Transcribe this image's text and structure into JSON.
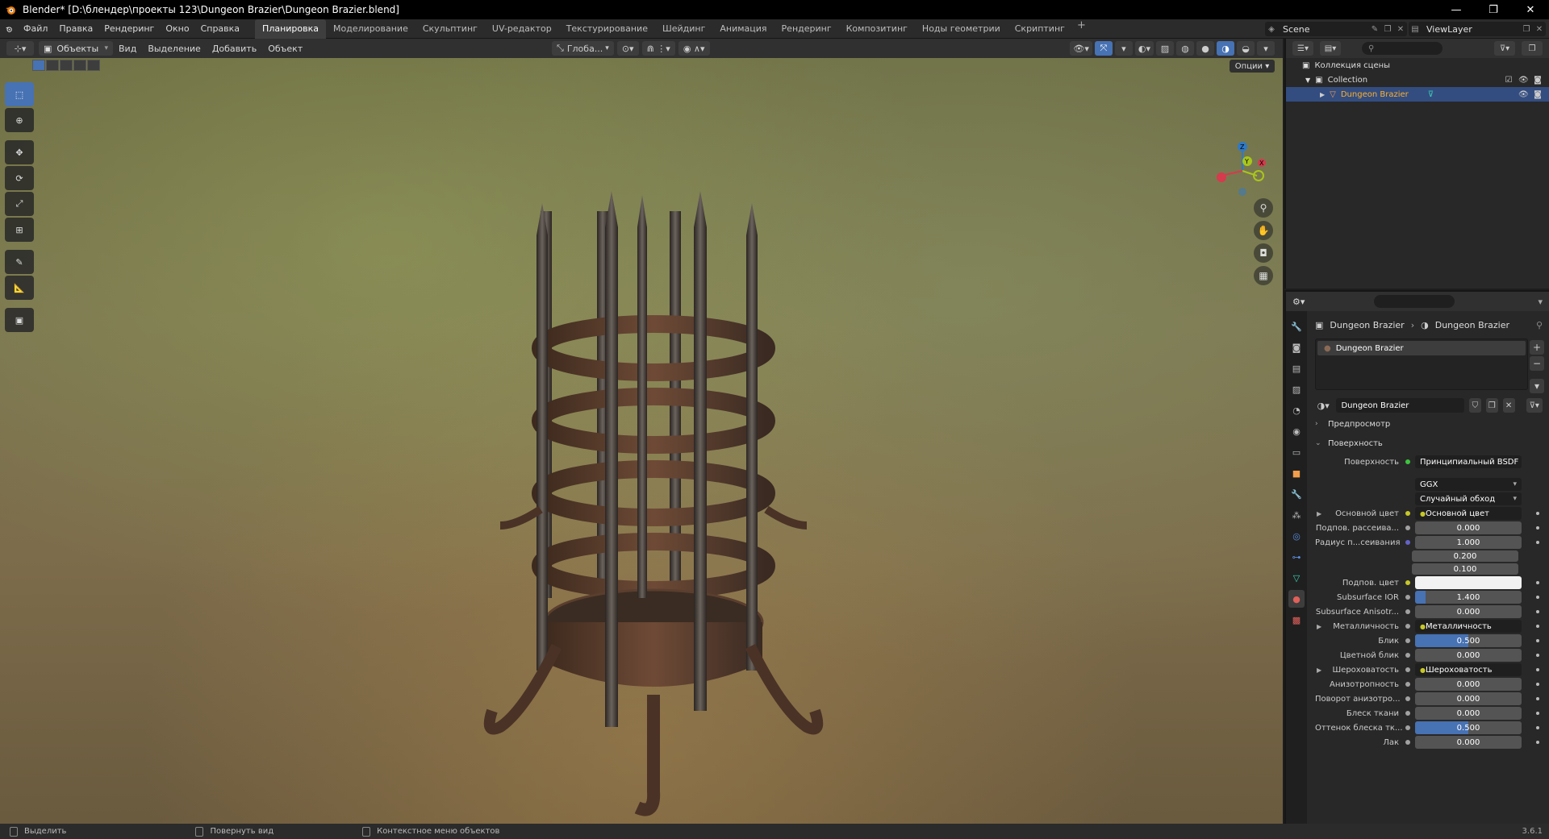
{
  "titlebar": {
    "title": "Blender* [D:\\блендер\\проекты 123\\Dungeon Brazier\\Dungeon Brazier.blend]",
    "minimize": "—",
    "maximize": "❐",
    "close": "✕"
  },
  "menu": {
    "items": [
      "Файл",
      "Правка",
      "Рендеринг",
      "Окно",
      "Справка"
    ]
  },
  "workspaces": {
    "tabs": [
      "Планировка",
      "Моделирование",
      "Скульптинг",
      "UV-редактор",
      "Текстурирование",
      "Шейдинг",
      "Анимация",
      "Рендеринг",
      "Композитинг",
      "Ноды геометрии",
      "Скриптинг"
    ],
    "active": "Планировка",
    "add": "+"
  },
  "scene": {
    "label": "Scene"
  },
  "view_layer": {
    "label": "ViewLayer"
  },
  "viewport_header": {
    "mode": "Объекты",
    "menus": [
      "Вид",
      "Выделение",
      "Добавить",
      "Объект"
    ],
    "transform_orientation": "Глоба...",
    "options": "Опции"
  },
  "toolbar": {
    "tools": [
      "select-box",
      "cursor",
      "move",
      "rotate",
      "scale",
      "transform",
      "annotate",
      "measure",
      "add-cube"
    ]
  },
  "gizmo": {
    "x": "X",
    "y": "Y",
    "z": "Z"
  },
  "statusbar": {
    "items": [
      "Выделить",
      "Повернуть вид",
      "Контекстное меню объектов"
    ],
    "version": "3.6.1"
  },
  "outliner": {
    "rows": [
      {
        "label": "Коллекция сцены"
      },
      {
        "label": "Collection"
      },
      {
        "label": "Dungeon Brazier"
      }
    ]
  },
  "properties": {
    "breadcrumb_object": "Dungeon Brazier",
    "breadcrumb_material": "Dungeon Brazier",
    "slot": "Dungeon Brazier",
    "material_name": "Dungeon Brazier",
    "panel_preview": "Предпросмотр",
    "panel_surface": "Поверхность",
    "surface_label": "Поверхность",
    "surface_value": "Принципиальный BSDF",
    "distribution": "GGX",
    "subsurface_method": "Случайный обход",
    "fields": [
      {
        "label": "Основной цвет",
        "value": "Основной цвет",
        "kind": "link",
        "sock": "#c7c729",
        "expand": true
      },
      {
        "label": "Подпов. рассеива...",
        "value": "0.000",
        "kind": "num",
        "sock": "#a1a1a1",
        "fill": 0
      },
      {
        "label": "Радиус п...сеивания",
        "value": "1.000",
        "kind": "num",
        "sock": "#6363c7",
        "fill": 0
      },
      {
        "label": "Подпов. цвет",
        "value": "",
        "kind": "white",
        "sock": "#c7c729"
      },
      {
        "label": "Subsurface IOR",
        "value": "1.400",
        "kind": "num",
        "sock": "#a1a1a1",
        "fill": 0.1
      },
      {
        "label": "Subsurface Anisotr...",
        "value": "0.000",
        "kind": "num",
        "sock": "#a1a1a1",
        "fill": 0
      },
      {
        "label": "Металличность",
        "value": "Металличность",
        "kind": "link",
        "sock": "#a1a1a1",
        "expand": true
      },
      {
        "label": "Блик",
        "value": "0.500",
        "kind": "num",
        "sock": "#a1a1a1",
        "fill": 0.5
      },
      {
        "label": "Цветной блик",
        "value": "0.000",
        "kind": "num",
        "sock": "#a1a1a1",
        "fill": 0
      },
      {
        "label": "Шероховатость",
        "value": "Шероховатость",
        "kind": "link",
        "sock": "#a1a1a1",
        "expand": true
      },
      {
        "label": "Анизотропность",
        "value": "0.000",
        "kind": "num",
        "sock": "#a1a1a1",
        "fill": 0
      },
      {
        "label": "Поворот анизотро...",
        "value": "0.000",
        "kind": "num",
        "sock": "#a1a1a1",
        "fill": 0
      },
      {
        "label": "Блеск ткани",
        "value": "0.000",
        "kind": "num",
        "sock": "#a1a1a1",
        "fill": 0
      },
      {
        "label": "Оттенок блеска тк...",
        "value": "0.500",
        "kind": "num",
        "sock": "#a1a1a1",
        "fill": 0.5
      },
      {
        "label": "Лак",
        "value": "0.000",
        "kind": "num",
        "sock": "#a1a1a1",
        "fill": 0
      }
    ],
    "radius_extra": [
      "0.200",
      "0.100"
    ]
  }
}
